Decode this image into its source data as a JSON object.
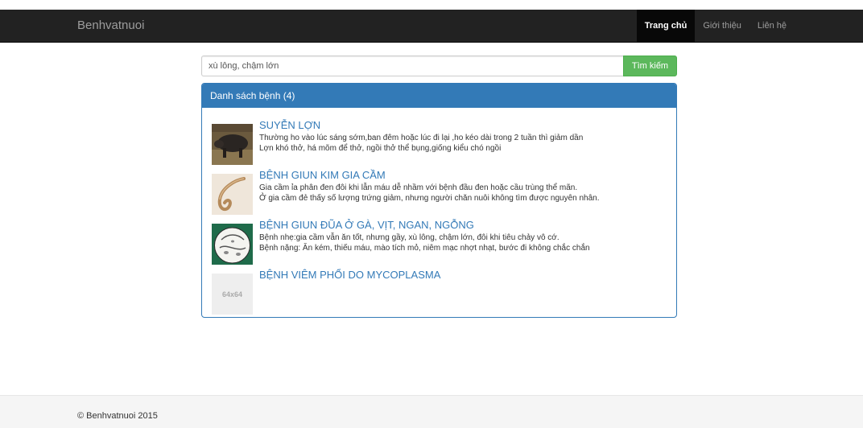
{
  "navbar": {
    "brand": "Benhvatnuoi",
    "items": [
      {
        "label": "Trang chủ",
        "active": true
      },
      {
        "label": "Giới thiệu",
        "active": false
      },
      {
        "label": "Liên hệ",
        "active": false
      }
    ]
  },
  "search": {
    "value": "xù lông, chậm lớn",
    "button_label": "Tìm kiếm"
  },
  "panel": {
    "heading": "Danh sách bệnh (4)",
    "items": [
      {
        "title": "SUYỄN LỢN",
        "thumb": "pig-photo",
        "lines": [
          "Thường ho vào lúc sáng sớm,ban đêm hoặc lúc đi lại ,ho kéo dài trong 2 tuần thì giảm dần",
          "Lợn khó thở, há mõm để thở, ngồi thở thể bụng,giống kiểu chó ngồi"
        ]
      },
      {
        "title": "BỆNH GIUN KIM GIA CẦM",
        "thumb": "pinworm-photo",
        "lines": [
          "Gia cầm ỉa phân đen đôi khi lẫn máu dễ nhầm với bệnh đầu đen hoặc cầu trùng thể mãn.",
          "Ở gia cầm đẻ thấy số lượng trứng giảm, nhưng người chăn nuôi không tìm được nguyên nhân."
        ]
      },
      {
        "title": "BỆNH GIUN ĐŨA Ở GÀ, VỊT, NGAN, NGỖNG",
        "thumb": "roundworm-diagram",
        "lines": [
          "Bệnh nhẹ:gia cầm vẫn ăn tốt, nhưng gầy, xù lông, chậm lớn, đôi khi tiêu chảy vô cớ.",
          "Bệnh nặng: Ăn kém, thiếu máu, mào tích mỏ, niêm mạc nhợt nhạt, bước đi không chắc chắn"
        ]
      },
      {
        "title": "BỆNH VIÊM PHỔI DO MYCOPLASMA",
        "thumb": "placeholder",
        "placeholder_text": "64x64",
        "lines": []
      }
    ]
  },
  "footer": {
    "text": "© Benhvatnuoi 2015"
  }
}
